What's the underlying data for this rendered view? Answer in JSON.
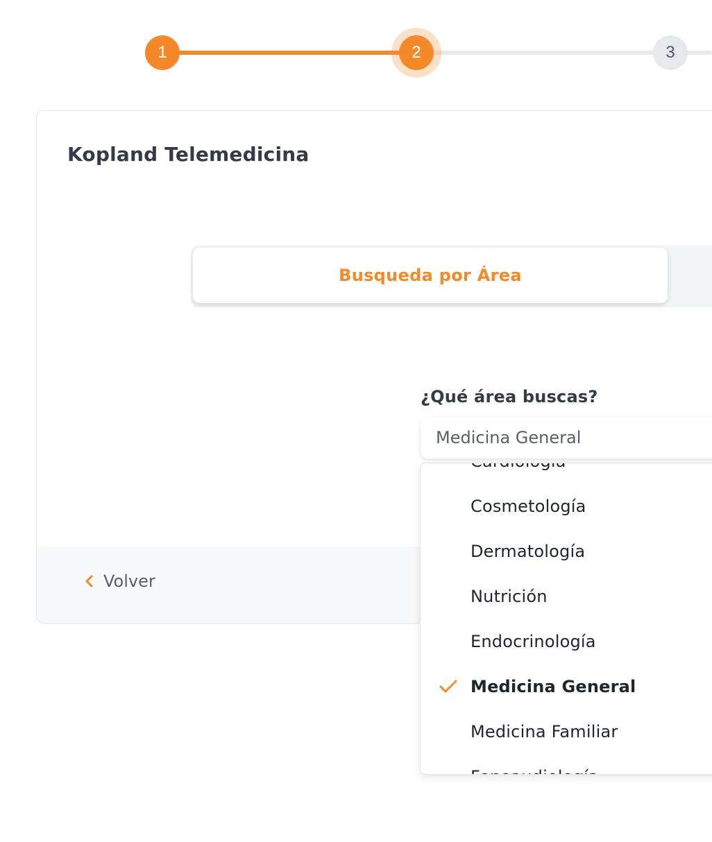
{
  "stepper": {
    "steps": [
      {
        "label": "1",
        "state": "completed"
      },
      {
        "label": "2",
        "state": "current"
      },
      {
        "label": "3",
        "state": "pending"
      }
    ]
  },
  "card": {
    "title": "Kopland Telemedicina",
    "tab_active_label": "Busqueda por Área",
    "question_label": "¿Qué área buscas?",
    "select_value": "Medicina General",
    "back_label": "Volver"
  },
  "dropdown": {
    "options": [
      "Cardiología",
      "Cosmetología",
      "Dermatología",
      "Nutrición",
      "Endocrinología",
      "Medicina General",
      "Medicina Familiar",
      "Fonoaudiología"
    ],
    "selected": "Medicina General"
  },
  "colors": {
    "accent": "#f5892a",
    "text_dark": "#333b48",
    "text_muted": "#5a5f67",
    "inactive_step": "#e6e8eb"
  },
  "icons": {
    "back": "chevron-left-icon",
    "selected_marker": "check-icon"
  }
}
